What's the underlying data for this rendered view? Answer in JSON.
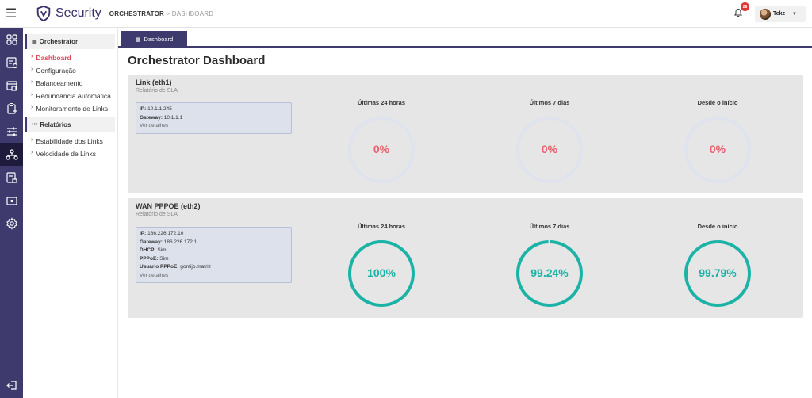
{
  "header": {
    "brand": "Security",
    "breadcrumb_root": "ORCHESTRATOR",
    "breadcrumb_sep": " > ",
    "breadcrumb_page": "DASHBOARD",
    "notifications_count": "28",
    "user_name": "Tekz",
    "icons": {
      "menu": "hamburger-icon",
      "bell": "bell-icon",
      "caret": "caret-down-icon",
      "logo": "shield-logo-icon"
    }
  },
  "iconbar": {
    "items": [
      "dashboard-grid-icon",
      "list-check-icon",
      "browser-window-icon",
      "clipboard-icon",
      "sliders-icon",
      "network-orchestrator-icon",
      "document-lock-icon",
      "id-card-icon",
      "gear-icon"
    ],
    "active_index": 5,
    "logout_icon": "logout-icon"
  },
  "sidebar": {
    "section1": {
      "label": "Orchestrator",
      "icon": "network-icon"
    },
    "items1": [
      "Dashboard",
      "Configuração",
      "Balanceamento",
      "Redundância Automática",
      "Monitoramento de Links"
    ],
    "active_item": "Dashboard",
    "section2": {
      "label": "Relatórios",
      "icon": "dots-icon"
    },
    "items2": [
      "Estabilidade dos Links",
      "Velocidade de Links"
    ]
  },
  "main": {
    "tab_label": "Dashboard",
    "page_title": "Orchestrator Dashboard",
    "period_labels": [
      "Últimas 24 horas",
      "Últimos 7 dias",
      "Desde o início"
    ],
    "links": [
      {
        "title": "Link (eth1)",
        "subtitle": "Relatório de SLA",
        "info": [
          {
            "key": "IP:",
            "value": "10.1.1.245"
          },
          {
            "key": "Gateway:",
            "value": "10.1.1.1"
          }
        ],
        "details_link": "Ver detalhes",
        "sla": [
          {
            "text": "0%",
            "fraction": 0
          },
          {
            "text": "0%",
            "fraction": 0
          },
          {
            "text": "0%",
            "fraction": 0
          }
        ]
      },
      {
        "title": "WAN PPPOE (eth2)",
        "subtitle": "Relatório de SLA",
        "info": [
          {
            "key": "IP:",
            "value": "186.226.172.10"
          },
          {
            "key": "Gateway:",
            "value": "186.226.172.1"
          },
          {
            "key": "DHCP:",
            "value": "Sim"
          },
          {
            "key": "PPPoE:",
            "value": "Sim"
          },
          {
            "key": "Usuário PPPoE:",
            "value": "gontijo.matriz"
          }
        ],
        "details_link": "Ver detalhes",
        "sla": [
          {
            "text": "100%",
            "fraction": 1.0
          },
          {
            "text": "99.24%",
            "fraction": 0.9924
          },
          {
            "text": "99.79%",
            "fraction": 0.9979
          }
        ]
      }
    ]
  },
  "colors": {
    "brand_purple": "#3f3a6e",
    "active_red": "#e0455a",
    "gauge_zero_text": "#e8606e",
    "gauge_ok": "#1ab3a6",
    "gauge_track": "#dfe3ee"
  }
}
